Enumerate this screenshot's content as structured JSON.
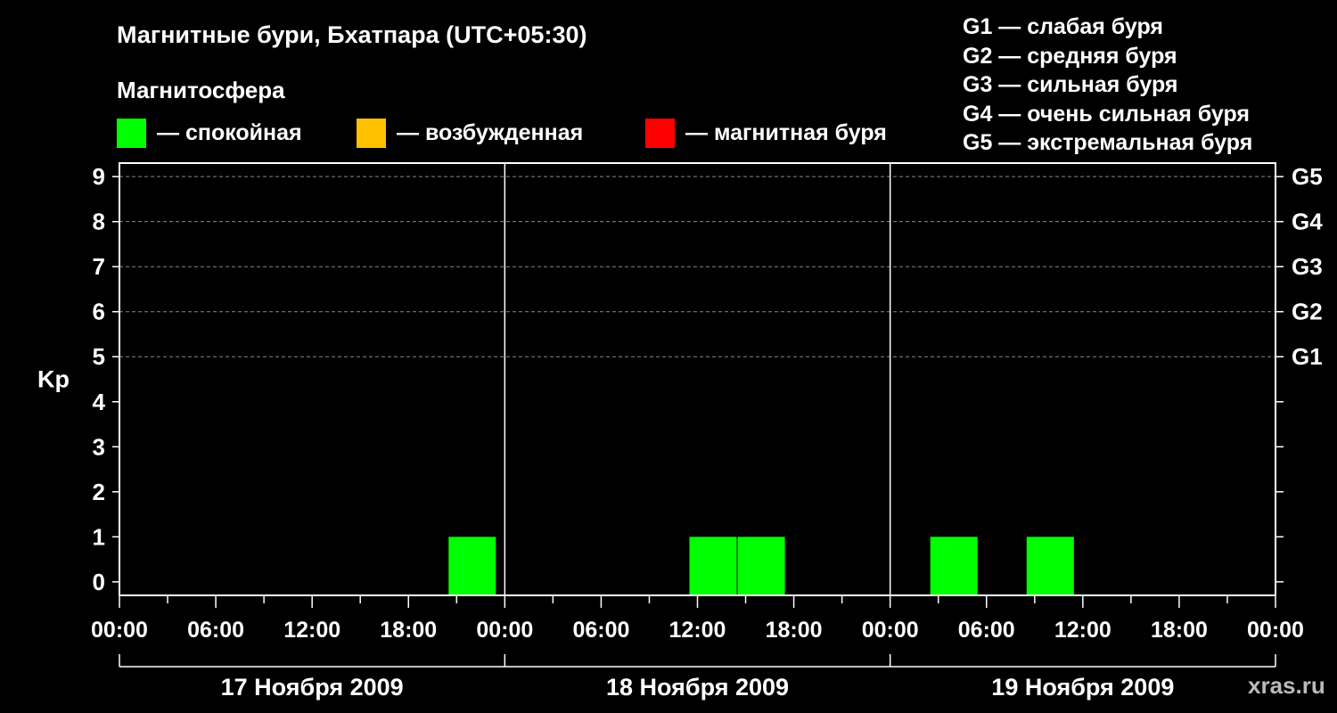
{
  "header": {
    "title": "Магнитные бури, Бхатпара (UTC+05:30)",
    "subtitle": "Магнитосфера"
  },
  "legend": [
    {
      "label": "— спокойная",
      "color": "#00ff00"
    },
    {
      "label": "— возбужденная",
      "color": "#ffc000"
    },
    {
      "label": "— магнитная буря",
      "color": "#ff0000"
    }
  ],
  "storm_levels": [
    "G1 — слабая буря",
    "G2 — средняя буря",
    "G3 — сильная буря",
    "G4 — очень сильная буря",
    "G5 — экстремальная буря"
  ],
  "watermark": "xras.ru",
  "chart_data": {
    "type": "bar",
    "title": "Магнитные бури, Бхатпара (UTC+05:30)",
    "ylabel": "Kp",
    "ylim": [
      -0.3,
      9.3
    ],
    "y_ticks": [
      0,
      1,
      2,
      3,
      4,
      5,
      6,
      7,
      8,
      9
    ],
    "right_axis_labels": [
      {
        "kp": 5,
        "label": "G1"
      },
      {
        "kp": 6,
        "label": "G2"
      },
      {
        "kp": 7,
        "label": "G3"
      },
      {
        "kp": 8,
        "label": "G4"
      },
      {
        "kp": 9,
        "label": "G5"
      }
    ],
    "x_range_hours": [
      0,
      72
    ],
    "x_tick_labels": [
      "00:00",
      "06:00",
      "12:00",
      "18:00",
      "00:00",
      "06:00",
      "12:00",
      "18:00",
      "00:00",
      "06:00",
      "12:00",
      "18:00",
      "00:00"
    ],
    "day_labels": [
      "17 Ноября 2009",
      "18 Ноября 2009",
      "19 Ноября 2009"
    ],
    "grid": "dashed horizontal at Kp 5-9",
    "bars": [
      {
        "start_hour": 20.5,
        "end_hour": 23.5,
        "kp": 1,
        "level": "quiet"
      },
      {
        "start_hour": 35.5,
        "end_hour": 38.5,
        "kp": 1,
        "level": "quiet"
      },
      {
        "start_hour": 38.5,
        "end_hour": 41.5,
        "kp": 1,
        "level": "quiet"
      },
      {
        "start_hour": 50.5,
        "end_hour": 53.5,
        "kp": 1,
        "level": "quiet"
      },
      {
        "start_hour": 56.5,
        "end_hour": 59.5,
        "kp": 1,
        "level": "quiet"
      }
    ]
  }
}
